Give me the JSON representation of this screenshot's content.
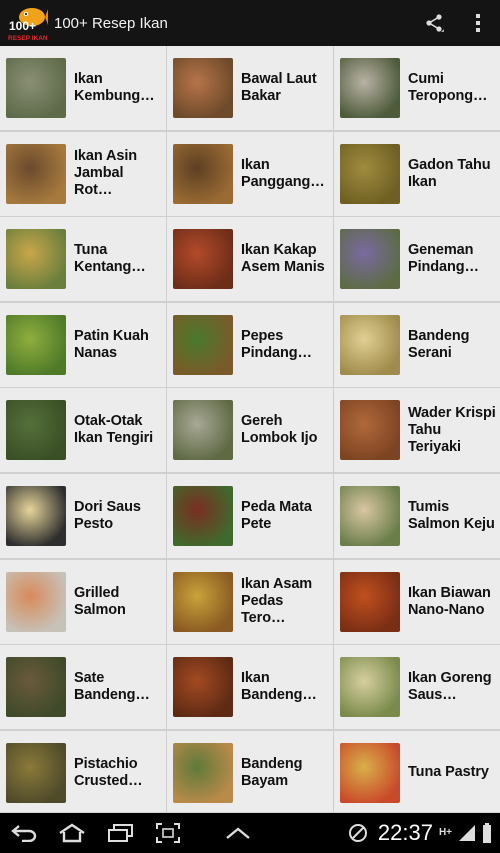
{
  "app": {
    "title": "100+ Resep Ikan",
    "logo_text_top": "100+",
    "logo_text_bottom": "RESEP IKAN"
  },
  "actionbar": {
    "share_icon": "share-icon",
    "overflow_icon": "overflow-menu-icon"
  },
  "recipes": [
    {
      "name": "Ikan Kembung…",
      "thumb": [
        "#8a8f74",
        "#5e6b4a"
      ]
    },
    {
      "name": "Bawal Laut Bakar",
      "thumb": [
        "#b7744a",
        "#6d4a2a"
      ]
    },
    {
      "name": "Cumi Teropong…",
      "thumb": [
        "#b9b2a5",
        "#4e5b3a"
      ]
    },
    {
      "name": "Ikan Asin Jambal Rot…",
      "thumb": [
        "#6b4a2c",
        "#a67a3e"
      ]
    },
    {
      "name": "Ikan Panggang…",
      "thumb": [
        "#5d3f24",
        "#9a6b33"
      ]
    },
    {
      "name": "Gadon Tahu Ikan",
      "thumb": [
        "#a08b3e",
        "#6f6022"
      ]
    },
    {
      "name": "Tuna Kentang…",
      "thumb": [
        "#c9a64a",
        "#6b7f3d"
      ]
    },
    {
      "name": "Ikan Kakap Asem Manis",
      "thumb": [
        "#b34a2a",
        "#6e2d19"
      ]
    },
    {
      "name": "Geneman Pindang…",
      "thumb": [
        "#7a6aa0",
        "#5d6b45"
      ]
    },
    {
      "name": "Patin Kuah Nanas",
      "thumb": [
        "#8fae3f",
        "#4f7a28"
      ]
    },
    {
      "name": "Pepes Pindang…",
      "thumb": [
        "#4a7a2e",
        "#7a5a2a"
      ]
    },
    {
      "name": "Bandeng Serani",
      "thumb": [
        "#e0cf94",
        "#a08c4a"
      ]
    },
    {
      "name": "Otak-Otak Ikan Tengiri",
      "thumb": [
        "#55703a",
        "#3a4f26"
      ]
    },
    {
      "name": "Gereh Lombok Ijo",
      "thumb": [
        "#a8a896",
        "#5f6a45"
      ]
    },
    {
      "name": "Wader Krispi Tahu Teriyaki",
      "thumb": [
        "#b0683a",
        "#7d4422"
      ]
    },
    {
      "name": "Dori Saus Pesto",
      "thumb": [
        "#e6d59a",
        "#2e2e2e"
      ]
    },
    {
      "name": "Peda Mata Pete",
      "thumb": [
        "#7a2e22",
        "#3f6a2c"
      ]
    },
    {
      "name": "Tumis Salmon Keju",
      "thumb": [
        "#d9c6a2",
        "#6a7e4a"
      ]
    },
    {
      "name": "Grilled Salmon",
      "thumb": [
        "#d88a5a",
        "#c7c2b8"
      ]
    },
    {
      "name": "Ikan Asam Pedas Tero…",
      "thumb": [
        "#c9a23a",
        "#8a5a22"
      ]
    },
    {
      "name": "Ikan Biawan Nano-Nano",
      "thumb": [
        "#c0501f",
        "#7a2e14"
      ]
    },
    {
      "name": "Sate Bandeng…",
      "thumb": [
        "#6a5a3a",
        "#3f4a2a"
      ]
    },
    {
      "name": "Ikan Bandeng…",
      "thumb": [
        "#a34a22",
        "#5e2a14"
      ]
    },
    {
      "name": "Ikan Goreng Saus…",
      "thumb": [
        "#d6cfa0",
        "#7a8a4a"
      ]
    },
    {
      "name": "Pistachio Crusted…",
      "thumb": [
        "#8a7a3a",
        "#4f4a2a"
      ]
    },
    {
      "name": "Bandeng Bayam",
      "thumb": [
        "#5e7a3a",
        "#b98a4a"
      ]
    },
    {
      "name": "Tuna Pastry",
      "thumb": [
        "#d9b04a",
        "#c94a2a"
      ]
    }
  ],
  "navbar": {
    "back_icon": "back-icon",
    "home_icon": "home-icon",
    "recents_icon": "recent-apps-icon",
    "screenshot_icon": "screenshot-icon",
    "up_icon": "chevron-up-icon",
    "time": "22:37",
    "network": "H+"
  },
  "colors": {
    "actionbar": "#141414",
    "cell": "#ececec",
    "divider": "#cfcfcf",
    "navbar": "#000000"
  }
}
